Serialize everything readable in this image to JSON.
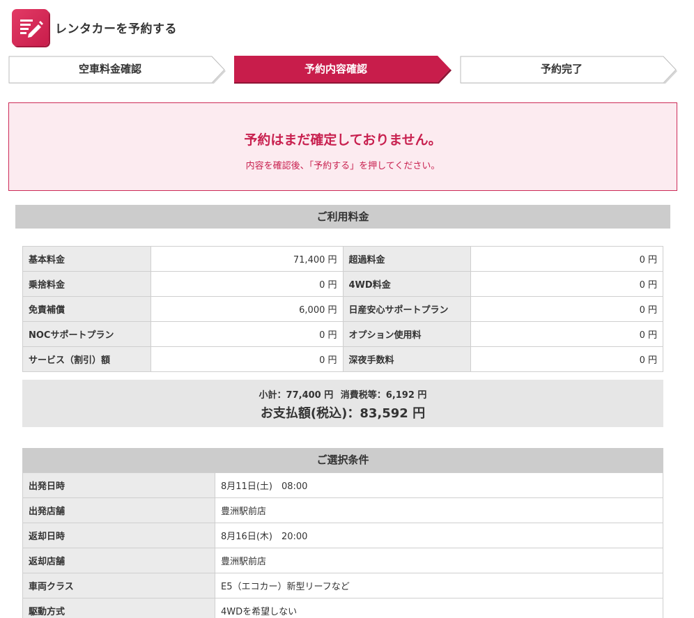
{
  "header": {
    "title": "レンタカーを予約する",
    "icon": "edit-icon"
  },
  "steps": [
    {
      "label": "空車料金確認",
      "active": false
    },
    {
      "label": "予約内容確認",
      "active": true
    },
    {
      "label": "予約完了",
      "active": false
    }
  ],
  "notice": {
    "title": "予約はまだ確定しておりません。",
    "subtitle": "内容を確認後、「予約する」を押してください。"
  },
  "fees": {
    "section_title": "ご利用料金",
    "rows": [
      {
        "l1": "基本料金",
        "v1": "71,400 円",
        "l2": "超過料金",
        "v2": "0 円"
      },
      {
        "l1": "乗捨料金",
        "v1": "0 円",
        "l2": "4WD料金",
        "v2": "0 円"
      },
      {
        "l1": "免責補償",
        "v1": "6,000 円",
        "l2": "日産安心サポートプラン",
        "v2": "0 円"
      },
      {
        "l1": "NOCサポートプラン",
        "v1": "0 円",
        "l2": "オプション使用料",
        "v2": "0 円"
      },
      {
        "l1": "サービス（割引）額",
        "v1": "0 円",
        "l2": "深夜手数料",
        "v2": "0 円"
      }
    ]
  },
  "summary": {
    "subtotal": "小計：77,400 円",
    "tax": "消費税等：6,192 円",
    "total": "お支払額(税込)：83,592 円"
  },
  "conditions": {
    "section_title": "ご選択条件",
    "rows": [
      {
        "label": "出発日時",
        "value": "8月11日(土)　08:00"
      },
      {
        "label": "出発店舗",
        "value": "豊洲駅前店"
      },
      {
        "label": "返却日時",
        "value": "8月16日(木)　20:00"
      },
      {
        "label": "返却店舗",
        "value": "豊洲駅前店"
      },
      {
        "label": "車両クラス",
        "value": "E5（エコカー）新型リーフなど"
      },
      {
        "label": "駆動方式",
        "value": "4WDを希望しない"
      }
    ]
  },
  "colors": {
    "accent": "#c81d4b",
    "notice_bg": "#fcebf0",
    "label_bg": "#ebebeb",
    "section_bg": "#cccccc"
  }
}
